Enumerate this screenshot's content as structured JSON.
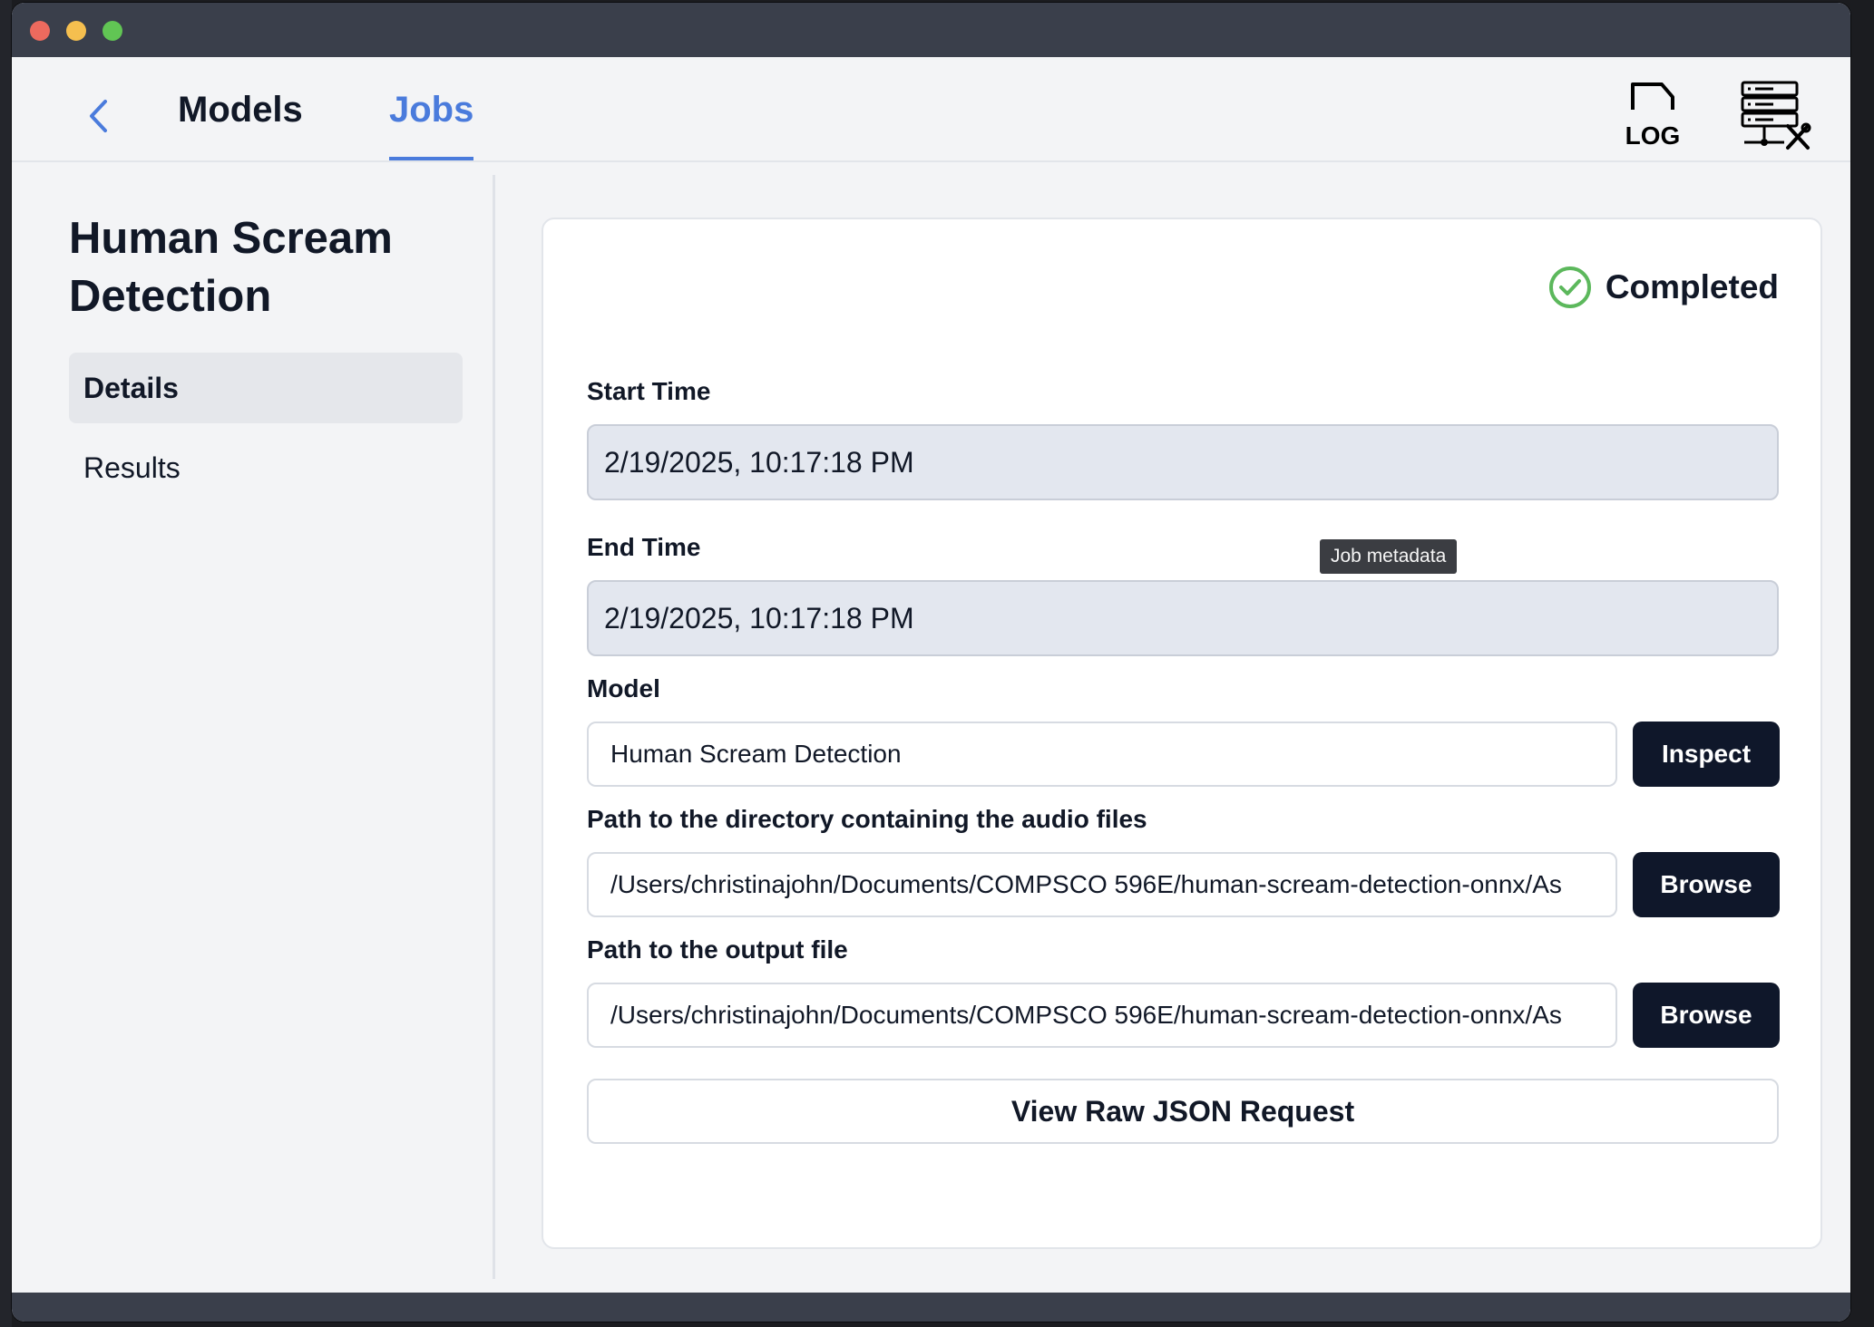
{
  "nav": {
    "tabs": [
      {
        "label": "Models"
      },
      {
        "label": "Jobs",
        "active": true
      }
    ],
    "log_label": "LOG"
  },
  "sidebar": {
    "title": "Human Scream Detection",
    "items": [
      {
        "label": "Details",
        "selected": true
      },
      {
        "label": "Results"
      }
    ]
  },
  "job": {
    "status": "Completed",
    "start_time": {
      "label": "Start Time",
      "value": "2/19/2025, 10:17:18 PM"
    },
    "end_time": {
      "label": "End Time",
      "value": "2/19/2025, 10:17:18 PM"
    },
    "model": {
      "label": "Model",
      "value": "Human Scream Detection",
      "button": "Inspect"
    },
    "audio_dir": {
      "label": "Path to the directory containing the audio files",
      "value": "/Users/christinajohn/Documents/COMPSCO 596E/human-scream-detection-onnx/As",
      "button": "Browse"
    },
    "output_file": {
      "label": "Path to the output file",
      "value": "/Users/christinajohn/Documents/COMPSCO 596E/human-scream-detection-onnx/As",
      "button": "Browse"
    },
    "raw_json_button": "View Raw JSON Request"
  },
  "tooltip": "Job metadata",
  "colors": {
    "accent": "#4a7bdc",
    "dark_button": "#0f172a",
    "status_green": "#5cb85c",
    "titlebar": "#3a3f4b"
  },
  "icons": [
    "chevron-left-icon",
    "log-file-icon",
    "server-tools-icon",
    "check-circle-icon"
  ]
}
